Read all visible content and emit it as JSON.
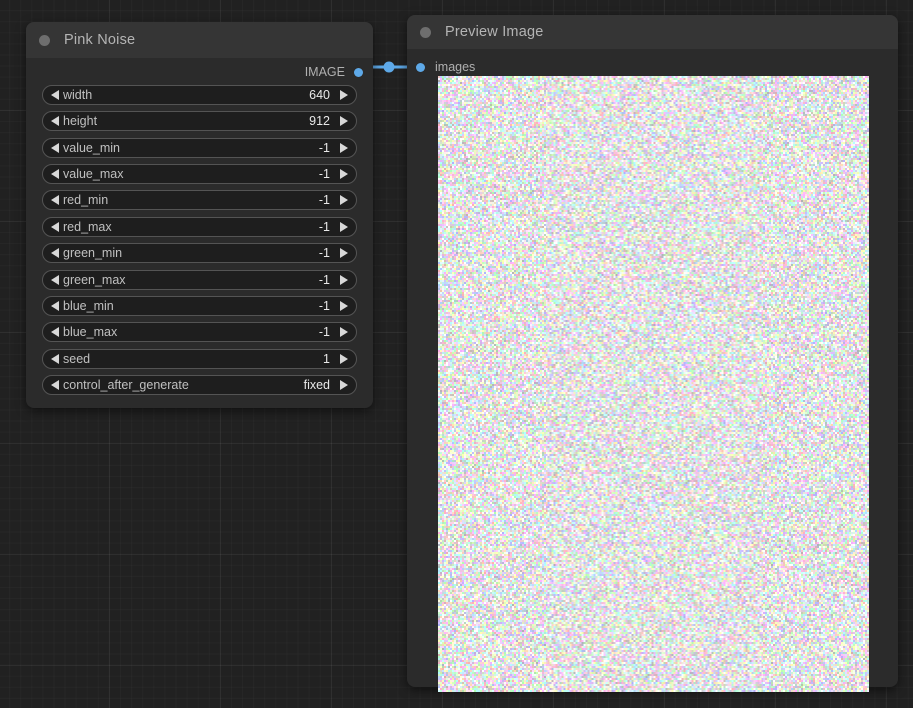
{
  "app": {
    "canvas_background": "#212121",
    "accent_color": "#5ea9e8",
    "node_body_color": "#2b2b2b",
    "node_title_color": "#353535"
  },
  "nodes": [
    {
      "id": "pink-noise",
      "title": "Pink Noise",
      "collapse_icon": "circle-icon",
      "outputs": [
        {
          "label": "IMAGE",
          "type": "IMAGE",
          "connected": true
        }
      ],
      "widgets": [
        {
          "name": "width",
          "value": "640",
          "left_icon": "triangle-left-icon",
          "right_icon": "triangle-right-icon"
        },
        {
          "name": "height",
          "value": "912",
          "left_icon": "triangle-left-icon",
          "right_icon": "triangle-right-icon"
        },
        {
          "name": "value_min",
          "value": "-1",
          "left_icon": "triangle-left-icon",
          "right_icon": "triangle-right-icon"
        },
        {
          "name": "value_max",
          "value": "-1",
          "left_icon": "triangle-left-icon",
          "right_icon": "triangle-right-icon"
        },
        {
          "name": "red_min",
          "value": "-1",
          "left_icon": "triangle-left-icon",
          "right_icon": "triangle-right-icon"
        },
        {
          "name": "red_max",
          "value": "-1",
          "left_icon": "triangle-left-icon",
          "right_icon": "triangle-right-icon"
        },
        {
          "name": "green_min",
          "value": "-1",
          "left_icon": "triangle-left-icon",
          "right_icon": "triangle-right-icon"
        },
        {
          "name": "green_max",
          "value": "-1",
          "left_icon": "triangle-left-icon",
          "right_icon": "triangle-right-icon"
        },
        {
          "name": "blue_min",
          "value": "-1",
          "left_icon": "triangle-left-icon",
          "right_icon": "triangle-right-icon"
        },
        {
          "name": "blue_max",
          "value": "-1",
          "left_icon": "triangle-left-icon",
          "right_icon": "triangle-right-icon"
        },
        {
          "name": "seed",
          "value": "1",
          "left_icon": "triangle-left-icon",
          "right_icon": "triangle-right-icon"
        },
        {
          "name": "control_after_generate",
          "value": "fixed",
          "left_icon": "triangle-left-icon",
          "right_icon": "triangle-right-icon"
        }
      ]
    },
    {
      "id": "preview-image",
      "title": "Preview Image",
      "collapse_icon": "circle-icon",
      "inputs": [
        {
          "label": "images",
          "type": "IMAGE",
          "connected": true
        }
      ],
      "image": {
        "alt": "rgb-noise-preview",
        "background": "#ebe8ee"
      }
    }
  ],
  "links": [
    {
      "from": "pink-noise.IMAGE",
      "to": "preview-image.images",
      "color": "#5ea9e8",
      "has_midpoint_dot": true
    }
  ]
}
